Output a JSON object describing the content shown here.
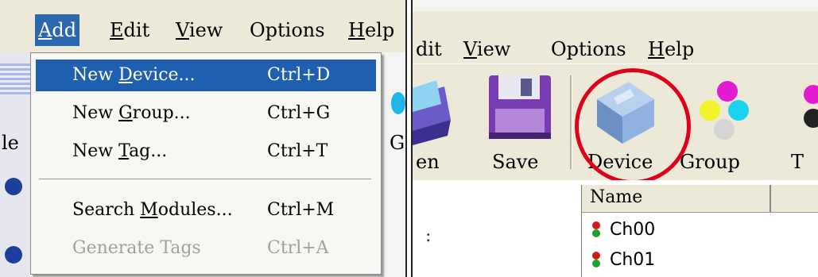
{
  "left_menu": {
    "items": [
      {
        "pre": "",
        "u": "A",
        "post": "dd"
      },
      {
        "pre": "",
        "u": "E",
        "post": "dit"
      },
      {
        "pre": "",
        "u": "V",
        "post": "iew"
      },
      {
        "pre": "",
        "u": "",
        "post": "Options"
      },
      {
        "pre": "",
        "u": "H",
        "post": "elp"
      }
    ],
    "background_glyphs": {
      "left_partial": "le",
      "right_partial": "G"
    }
  },
  "dropdown": {
    "items": [
      {
        "pre": "New ",
        "u": "D",
        "post": "evice...",
        "shortcut": "Ctrl+D",
        "highlighted": true,
        "enabled": true
      },
      {
        "pre": "New ",
        "u": "G",
        "post": "roup...",
        "shortcut": "Ctrl+G",
        "highlighted": false,
        "enabled": true
      },
      {
        "pre": "New ",
        "u": "T",
        "post": "ag...",
        "shortcut": "Ctrl+T",
        "highlighted": false,
        "enabled": true
      },
      {
        "pre": "Search ",
        "u": "M",
        "post": "odules...",
        "shortcut": "Ctrl+M",
        "highlighted": false,
        "enabled": true
      },
      {
        "pre": "Generate Tags",
        "u": "",
        "post": "",
        "shortcut": "Ctrl+A",
        "highlighted": false,
        "enabled": false
      }
    ]
  },
  "right_menu": {
    "items": [
      {
        "pre": "",
        "u": "",
        "post": "dit"
      },
      {
        "pre": "",
        "u": "V",
        "post": "iew"
      },
      {
        "pre": "",
        "u": "",
        "post": "Options"
      },
      {
        "pre": "",
        "u": "H",
        "post": "elp"
      }
    ]
  },
  "toolbar": {
    "open_label": "en",
    "save_label": "Save",
    "device_label": "Device",
    "group_label": "Group",
    "tag_label": "T",
    "highlight_color": "#e0001a"
  },
  "tree": {
    "stub_text": ":"
  },
  "list": {
    "column_name": "Name",
    "rows": [
      {
        "name": "Ch00",
        "icon": "traffic-light-icon"
      },
      {
        "name": "Ch01",
        "icon": "traffic-light-icon"
      }
    ]
  }
}
